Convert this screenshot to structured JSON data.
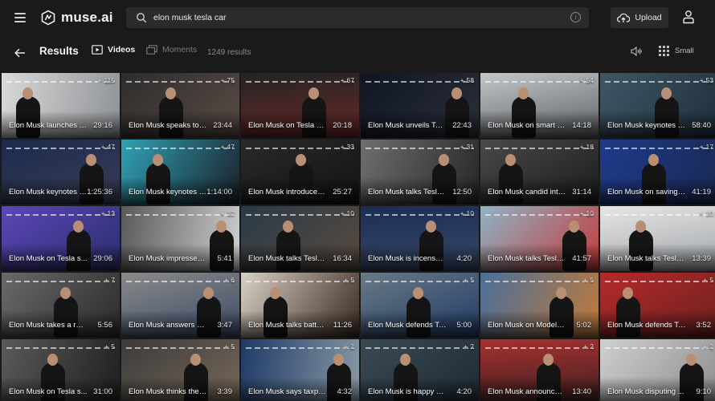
{
  "app": {
    "name": "muse.ai"
  },
  "search": {
    "value": "elon musk tesla car"
  },
  "header": {
    "upload_label": "Upload"
  },
  "subbar": {
    "title": "Results",
    "tabs": [
      {
        "label": "Videos",
        "active": true
      },
      {
        "label": "Moments",
        "active": false
      }
    ],
    "count": "1249 results",
    "size_label": "Small"
  },
  "videos": [
    {
      "title": "Elon Musk launches T...",
      "duration": "29:16",
      "moments": "115",
      "bg": [
        "#d9d9d9",
        "#8f9296"
      ]
    },
    {
      "title": "Elon Musk speaks to f...",
      "duration": "23:44",
      "moments": "75",
      "bg": [
        "#2d2d2d",
        "#5a4b45"
      ]
    },
    {
      "title": "Elon Musk on Tesla wi...",
      "duration": "20:18",
      "moments": "67",
      "bg": [
        "#232323",
        "#6b2a2a"
      ]
    },
    {
      "title": "Elon Musk unveils Tes...",
      "duration": "22:43",
      "moments": "58",
      "bg": [
        "#0f1522",
        "#2a2f3a"
      ]
    },
    {
      "title": "Elon Musk on smart ro...",
      "duration": "14:18",
      "moments": "54",
      "bg": [
        "#c5c7c9",
        "#5b5f63"
      ]
    },
    {
      "title": "Elon Musk keynotes T...",
      "duration": "58:40",
      "moments": "53",
      "bg": [
        "#3f5766",
        "#1f2f3a"
      ]
    },
    {
      "title": "Elon Musk keynotes T...",
      "duration": "1:25:36",
      "moments": "47",
      "bg": [
        "#1c2a4d",
        "#3a3f55"
      ]
    },
    {
      "title": "Elon Musk keynotes T...",
      "duration": "1:14:00",
      "moments": "47",
      "bg": [
        "#2fa3b5",
        "#1b1f28"
      ]
    },
    {
      "title": "Elon Musk introduces ...",
      "duration": "25:27",
      "moments": "33",
      "bg": [
        "#2a2a2a",
        "#121212"
      ]
    },
    {
      "title": "Elon Musk talks Tesla ...",
      "duration": "12:50",
      "moments": "31",
      "bg": [
        "#6f6f6f",
        "#262626"
      ]
    },
    {
      "title": "Elon Musk candid inte...",
      "duration": "31:14",
      "moments": "18",
      "bg": [
        "#4a4a4a",
        "#1a1a1a"
      ]
    },
    {
      "title": "Elon Musk on saving T...",
      "duration": "41:19",
      "moments": "17",
      "bg": [
        "#1f3a8a",
        "#1a2a55"
      ]
    },
    {
      "title": "Elon Musk on Tesla s...",
      "duration": "29:06",
      "moments": "13",
      "bg": [
        "#5b47b8",
        "#2a2d6a"
      ]
    },
    {
      "title": "Elon Musk impresses j...",
      "duration": "5:41",
      "moments": "12",
      "bg": [
        "#5a5a5a",
        "#cfcfcf"
      ]
    },
    {
      "title": "Elon Musk talks Tesla ...",
      "duration": "16:34",
      "moments": "10",
      "bg": [
        "#2a3a47",
        "#5a4a3f"
      ]
    },
    {
      "title": "Elon Musk is incensed...",
      "duration": "4:20",
      "moments": "10",
      "bg": [
        "#1b2d55",
        "#3b4a6a"
      ]
    },
    {
      "title": "Elon Musk talks Tesla in ...",
      "duration": "41:57",
      "moments": "10",
      "bg": [
        "#8fb3c5",
        "#c23a3a"
      ]
    },
    {
      "title": "Elon Musk talks Tesla ...",
      "duration": "13:39",
      "moments": "10",
      "bg": [
        "#e6e6e6",
        "#9fa3a7"
      ]
    },
    {
      "title": "Elon Musk takes a rep...",
      "duration": "5:56",
      "moments": "7",
      "bg": [
        "#6a6a6a",
        "#2a2a2a"
      ]
    },
    {
      "title": "Elon Musk answers cri...",
      "duration": "3:47",
      "moments": "6",
      "bg": [
        "#8a8a8a",
        "#3a4a66"
      ]
    },
    {
      "title": "Elon Musk talks batter...",
      "duration": "11:26",
      "moments": "5",
      "bg": [
        "#d8d0c5",
        "#3a2a22"
      ]
    },
    {
      "title": "Elon Musk defends Te...",
      "duration": "5:00",
      "moments": "5",
      "bg": [
        "#6a7a86",
        "#1f3a66"
      ]
    },
    {
      "title": "Elon Musk on Model S L",
      "duration": "5:02",
      "moments": "5",
      "bg": [
        "#4a6f9a",
        "#c07a3a"
      ]
    },
    {
      "title": "Elon Musk defends Tes...",
      "duration": "3:52",
      "moments": "5",
      "bg": [
        "#b52a2a",
        "#6a2020"
      ]
    },
    {
      "title": "Elon Musk on Tesla s...",
      "duration": "31:00",
      "moments": "5",
      "bg": [
        "#5a5a5a",
        "#1f1f1f"
      ]
    },
    {
      "title": "Elon Musk thinks the ...",
      "duration": "3:39",
      "moments": "5",
      "bg": [
        "#3a3a3a",
        "#7a6a5a"
      ]
    },
    {
      "title": "Elon Musk says taxpa...",
      "duration": "4:32",
      "moments": "2",
      "bg": [
        "#1f3a66",
        "#8a9aa6"
      ]
    },
    {
      "title": "Elon Musk is happy wi...",
      "duration": "4:20",
      "moments": "2",
      "bg": [
        "#3a4a55",
        "#1f2a33"
      ]
    },
    {
      "title": "Elon Musk announces...",
      "duration": "13:40",
      "moments": "2",
      "bg": [
        "#a83030",
        "#3a2020"
      ]
    },
    {
      "title": "Elon Musk disputing ...",
      "duration": "9:10",
      "moments": "2",
      "bg": [
        "#d0d0d0",
        "#8a8a8a"
      ]
    }
  ]
}
